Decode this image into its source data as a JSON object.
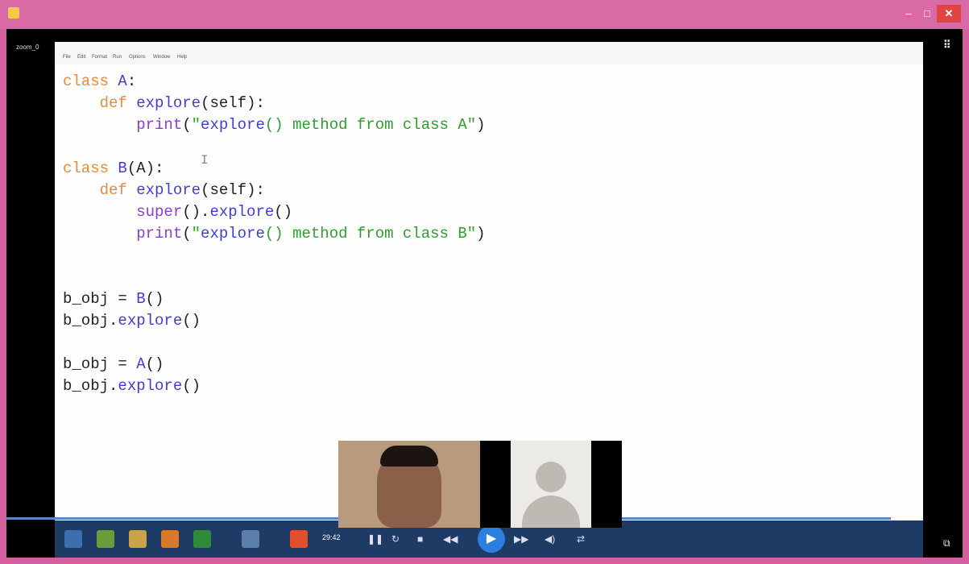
{
  "window": {
    "minimize": "–",
    "maximize": "□",
    "close": "✕"
  },
  "player": {
    "zoom_label": "zoom_0",
    "grid_icon": "⠿",
    "corner_icon": "⧉"
  },
  "editor": {
    "menu": [
      "File",
      "Edit",
      "Format",
      "Run",
      "Options",
      "Window",
      "Help"
    ],
    "code_lines": [
      "class A:",
      "    def explore(self):",
      "        print(\"explore() method from class A\")",
      "",
      "class B(A):",
      "    def explore(self):",
      "        super().explore()",
      "        print(\"explore() method from class B\")",
      "",
      "",
      "b_obj = B()",
      "b_obj.explore()",
      "",
      "b_obj = A()",
      "b_obj.explore()"
    ],
    "cursor": "I"
  },
  "controls": {
    "time": "29:42",
    "play": "▶",
    "pause_icon": "❚❚",
    "refresh_icon": "↻",
    "stop_icon": "■",
    "rewind_icon": "◀◀",
    "forward_icon": "▶▶",
    "volume_icon": "◀)",
    "loop_icon": "⇄"
  },
  "progress": 0.97,
  "icons": [
    "app-icon",
    "grid-icon",
    "play-icon",
    "user-avatar-icon"
  ],
  "colors": {
    "frame": "#d96aa6",
    "keyword": "#e88b3a",
    "function": "#3f3fd6",
    "string": "#2e9e2e",
    "builtin": "#8a3fd0"
  }
}
